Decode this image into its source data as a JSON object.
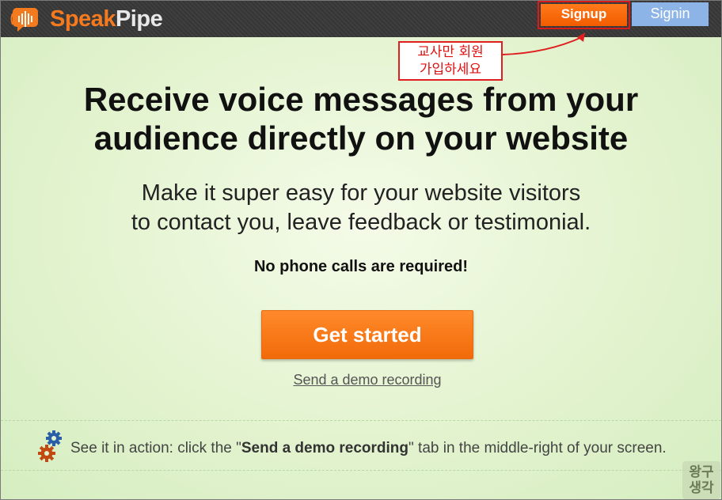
{
  "header": {
    "brand_part1": "Speak",
    "brand_part2": "Pipe",
    "logo_icon": "speech-bubble-sound-icon",
    "signup_label": "Signup",
    "signin_label": "Signin"
  },
  "annotation": {
    "line1": "교사만 회원",
    "line2": "가입하세요"
  },
  "hero": {
    "headline_line1": "Receive voice messages from your",
    "headline_line2": "audience directly on your website",
    "sub_line1": "Make it super easy for your website visitors",
    "sub_line2": "to contact you, leave feedback or testimonial.",
    "no_phone": "No phone calls are required!",
    "cta_label": "Get started",
    "demo_link": "Send a demo recording"
  },
  "action_bar": {
    "icon": "gears-icon",
    "prefix": "See it in action: click the \"",
    "bold": "Send a demo recording",
    "suffix": "\" tab in the middle-right of your screen."
  },
  "watermark": {
    "line1": "왕구",
    "line2": "생각"
  },
  "colors": {
    "brand_orange": "#f47a20",
    "signin_blue": "#8db4e6",
    "annotation_red": "#e02020"
  }
}
